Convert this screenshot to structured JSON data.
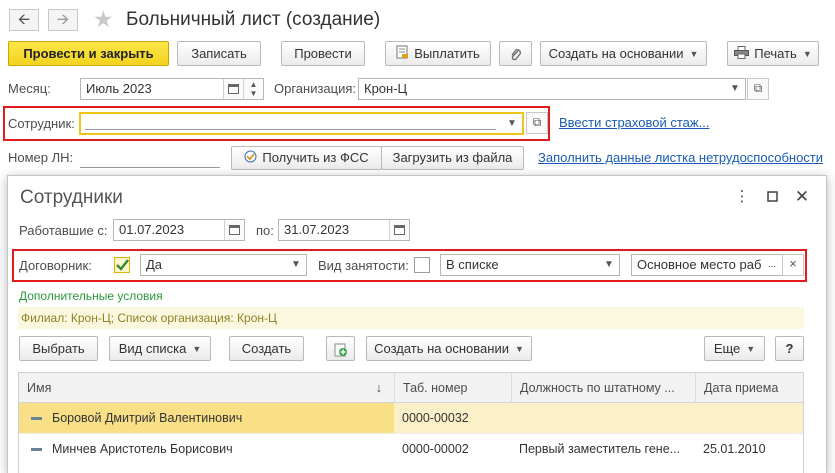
{
  "window": {
    "title": "Больничный лист (создание)",
    "back_icon": "arrow-left-icon",
    "forward_icon": "arrow-right-icon",
    "favorite_icon": "star-icon"
  },
  "toolbar": {
    "post_close": "Провести и закрыть",
    "save": "Записать",
    "post": "Провести",
    "pay": "Выплатить",
    "create_based": "Создать на основании",
    "print": "Печать"
  },
  "form": {
    "month_label": "Месяц:",
    "month_value": "Июль 2023",
    "org_label": "Организация:",
    "org_value": "Крон-Ц",
    "employee_label": "Сотрудник:",
    "employee_value": "",
    "insurance_link": "Ввести страховой стаж...",
    "ln_label": "Номер ЛН:",
    "ln_value": "",
    "get_fss": "Получить из ФСС",
    "load_file": "Загрузить из файла",
    "fill_link": "Заполнить данные листка нетрудоспособности"
  },
  "dialog": {
    "title": "Сотрудники",
    "worked_from_label": "Работавшие с:",
    "date_from": "01.07.2023",
    "to_label": "по:",
    "date_to": "31.07.2023",
    "contractor_label": "Договорник:",
    "contractor_checked": true,
    "contractor_value": "Да",
    "employment_label": "Вид занятости:",
    "employment_checked": false,
    "employment_condition": "В списке",
    "employment_value": "Основное место раб",
    "more_dots": "...",
    "clear_x": "×",
    "extra_conditions": "Дополнительные условия",
    "filter_info": "Филиал: Крон-Ц; Список организация: Крон-Ц",
    "buttons": {
      "select": "Выбрать",
      "list_view": "Вид списка",
      "create": "Создать",
      "create_based": "Создать на основании",
      "more": "Еще",
      "help": "?"
    },
    "columns": [
      "Имя",
      "Таб. номер",
      "Должность по штатному ...",
      "Дата приема"
    ],
    "sort_indicator": "↓",
    "rows": [
      {
        "name": "Боровой Дмитрий Валентинович",
        "tab": "0000-00032",
        "position": "",
        "hire_date": ""
      },
      {
        "name": "Минчев Аристотель Борисович",
        "tab": "0000-00002",
        "position": "Первый заместитель гене...",
        "hire_date": "25.01.2010"
      }
    ]
  },
  "colors": {
    "accent_yellow": "#f5d624",
    "highlight_red": "#e01b1b",
    "link_blue": "#1a5cb5",
    "selected_row": "#fbe9a6",
    "green_text": "#2b9a3a"
  }
}
